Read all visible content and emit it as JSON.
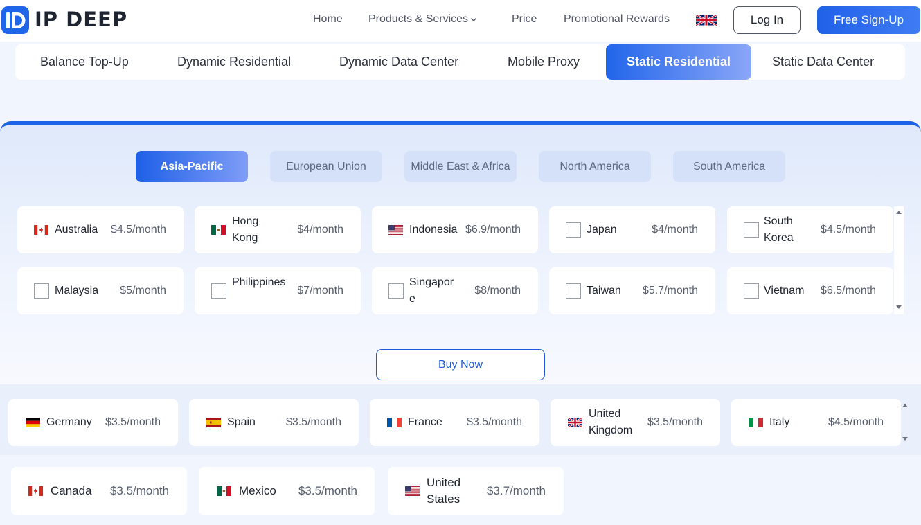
{
  "header": {
    "brand": "IP DEEP",
    "nav": [
      "Home",
      "Products & Services",
      "Price",
      "Promotional Rewards"
    ],
    "login": "Log In",
    "signup": "Free Sign-Up"
  },
  "product_tabs": [
    "Balance Top-Up",
    "Dynamic Residential",
    "Dynamic Data Center",
    "Mobile Proxy",
    "Static Residential",
    "Static Data Center"
  ],
  "active_product_tab": "Static Residential",
  "region_tabs": [
    "Asia-Pacific",
    "European Union",
    "Middle East & Africa",
    "North America",
    "South America"
  ],
  "active_region_tab": "Asia-Pacific",
  "asia_pacific": [
    {
      "name": "Australia",
      "price": "$4.5/month",
      "icon": "canada-flag"
    },
    {
      "name": "Hong Kong",
      "price": "$4/month",
      "icon": "mexico-flag"
    },
    {
      "name": "Indonesia",
      "price": "$6.9/month",
      "icon": "us-flag"
    },
    {
      "name": "Japan",
      "price": "$4/month",
      "icon": "checkbox"
    },
    {
      "name": "South Korea",
      "price": "$4.5/month",
      "icon": "checkbox"
    },
    {
      "name": "Malaysia",
      "price": "$5/month",
      "icon": "checkbox"
    },
    {
      "name": "Philippines",
      "price": "$7/month",
      "icon": "checkbox"
    },
    {
      "name": "Singapore",
      "price": "$8/month",
      "icon": "checkbox"
    },
    {
      "name": "Taiwan",
      "price": "$5.7/month",
      "icon": "checkbox"
    },
    {
      "name": "Vietnam",
      "price": "$6.5/month",
      "icon": "checkbox"
    }
  ],
  "buy_now": "Buy Now",
  "european_union": [
    {
      "name": "Germany",
      "price": "$3.5/month",
      "icon": "germany-flag"
    },
    {
      "name": "Spain",
      "price": "$3.5/month",
      "icon": "spain-flag"
    },
    {
      "name": "France",
      "price": "$3.5/month",
      "icon": "france-flag"
    },
    {
      "name": "United Kingdom",
      "price": "$3.5/month",
      "icon": "uk-flag"
    },
    {
      "name": "Italy",
      "price": "$4.5/month",
      "icon": "italy-flag"
    }
  ],
  "north_america": [
    {
      "name": "Canada",
      "price": "$3.5/month",
      "icon": "canada-flag"
    },
    {
      "name": "Mexico",
      "price": "$3.5/month",
      "icon": "mexico-flag"
    },
    {
      "name": "United States",
      "price": "$3.7/month",
      "icon": "us-flag"
    }
  ],
  "colors": {
    "accent": "#1a64e5",
    "region_tab_bg": "#d4e1f8"
  }
}
